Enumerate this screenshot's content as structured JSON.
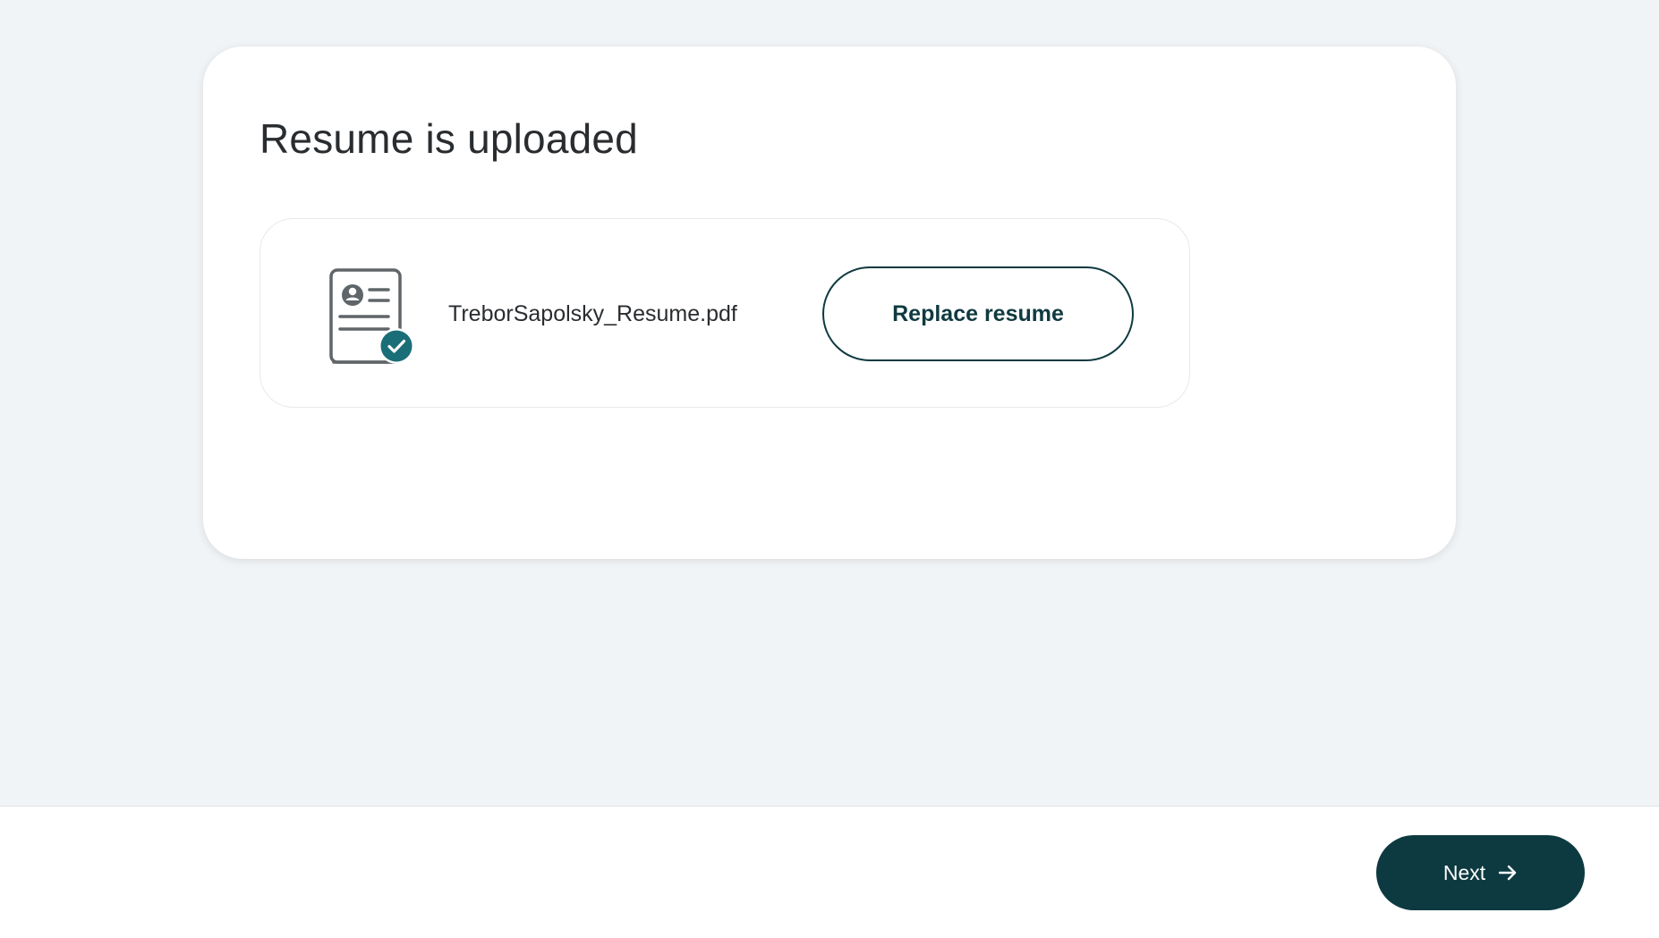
{
  "card": {
    "title": "Resume is uploaded"
  },
  "file": {
    "name": "TreborSapolsky_Resume.pdf",
    "icon": "resume-document-check-icon",
    "replace_label": "Replace resume"
  },
  "footer": {
    "next_label": "Next",
    "next_icon": "arrow-right-icon"
  },
  "colors": {
    "background": "#f1f4f6",
    "card": "#ffffff",
    "accent": "#0d3a40",
    "check_badge": "#1a6e78",
    "text": "#2a2d30"
  }
}
